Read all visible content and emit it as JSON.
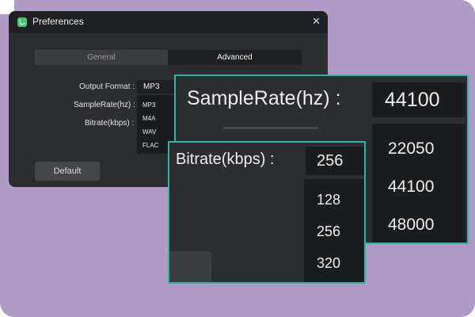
{
  "window": {
    "title": "Preferences",
    "close_glyph": "✕",
    "icon": "app-icon"
  },
  "tabs": [
    {
      "label": "General",
      "active": false
    },
    {
      "label": "Advanced",
      "active": true
    }
  ],
  "settings": {
    "output_format_label": "Output Format :",
    "output_format_value": "MP3",
    "output_format_options": [
      "MP3",
      "M4A",
      "WAV",
      "FLAC"
    ],
    "sample_rate_label": "SampleRate(hz) :",
    "bitrate_label": "Bitrate(kbps) :"
  },
  "buttons": {
    "default_label": "Default"
  },
  "zoom_sample_rate": {
    "label": "SampleRate(hz) :",
    "value": "44100",
    "options": [
      "22050",
      "44100",
      "48000"
    ]
  },
  "zoom_bitrate": {
    "label": "Bitrate(kbps) :",
    "value": "256",
    "options": [
      "128",
      "256",
      "320"
    ]
  },
  "colors": {
    "background": "#b09bc6",
    "window": "#2c2d30",
    "highlight_border": "#2bb7a4",
    "app_icon": "#4cc37b"
  }
}
